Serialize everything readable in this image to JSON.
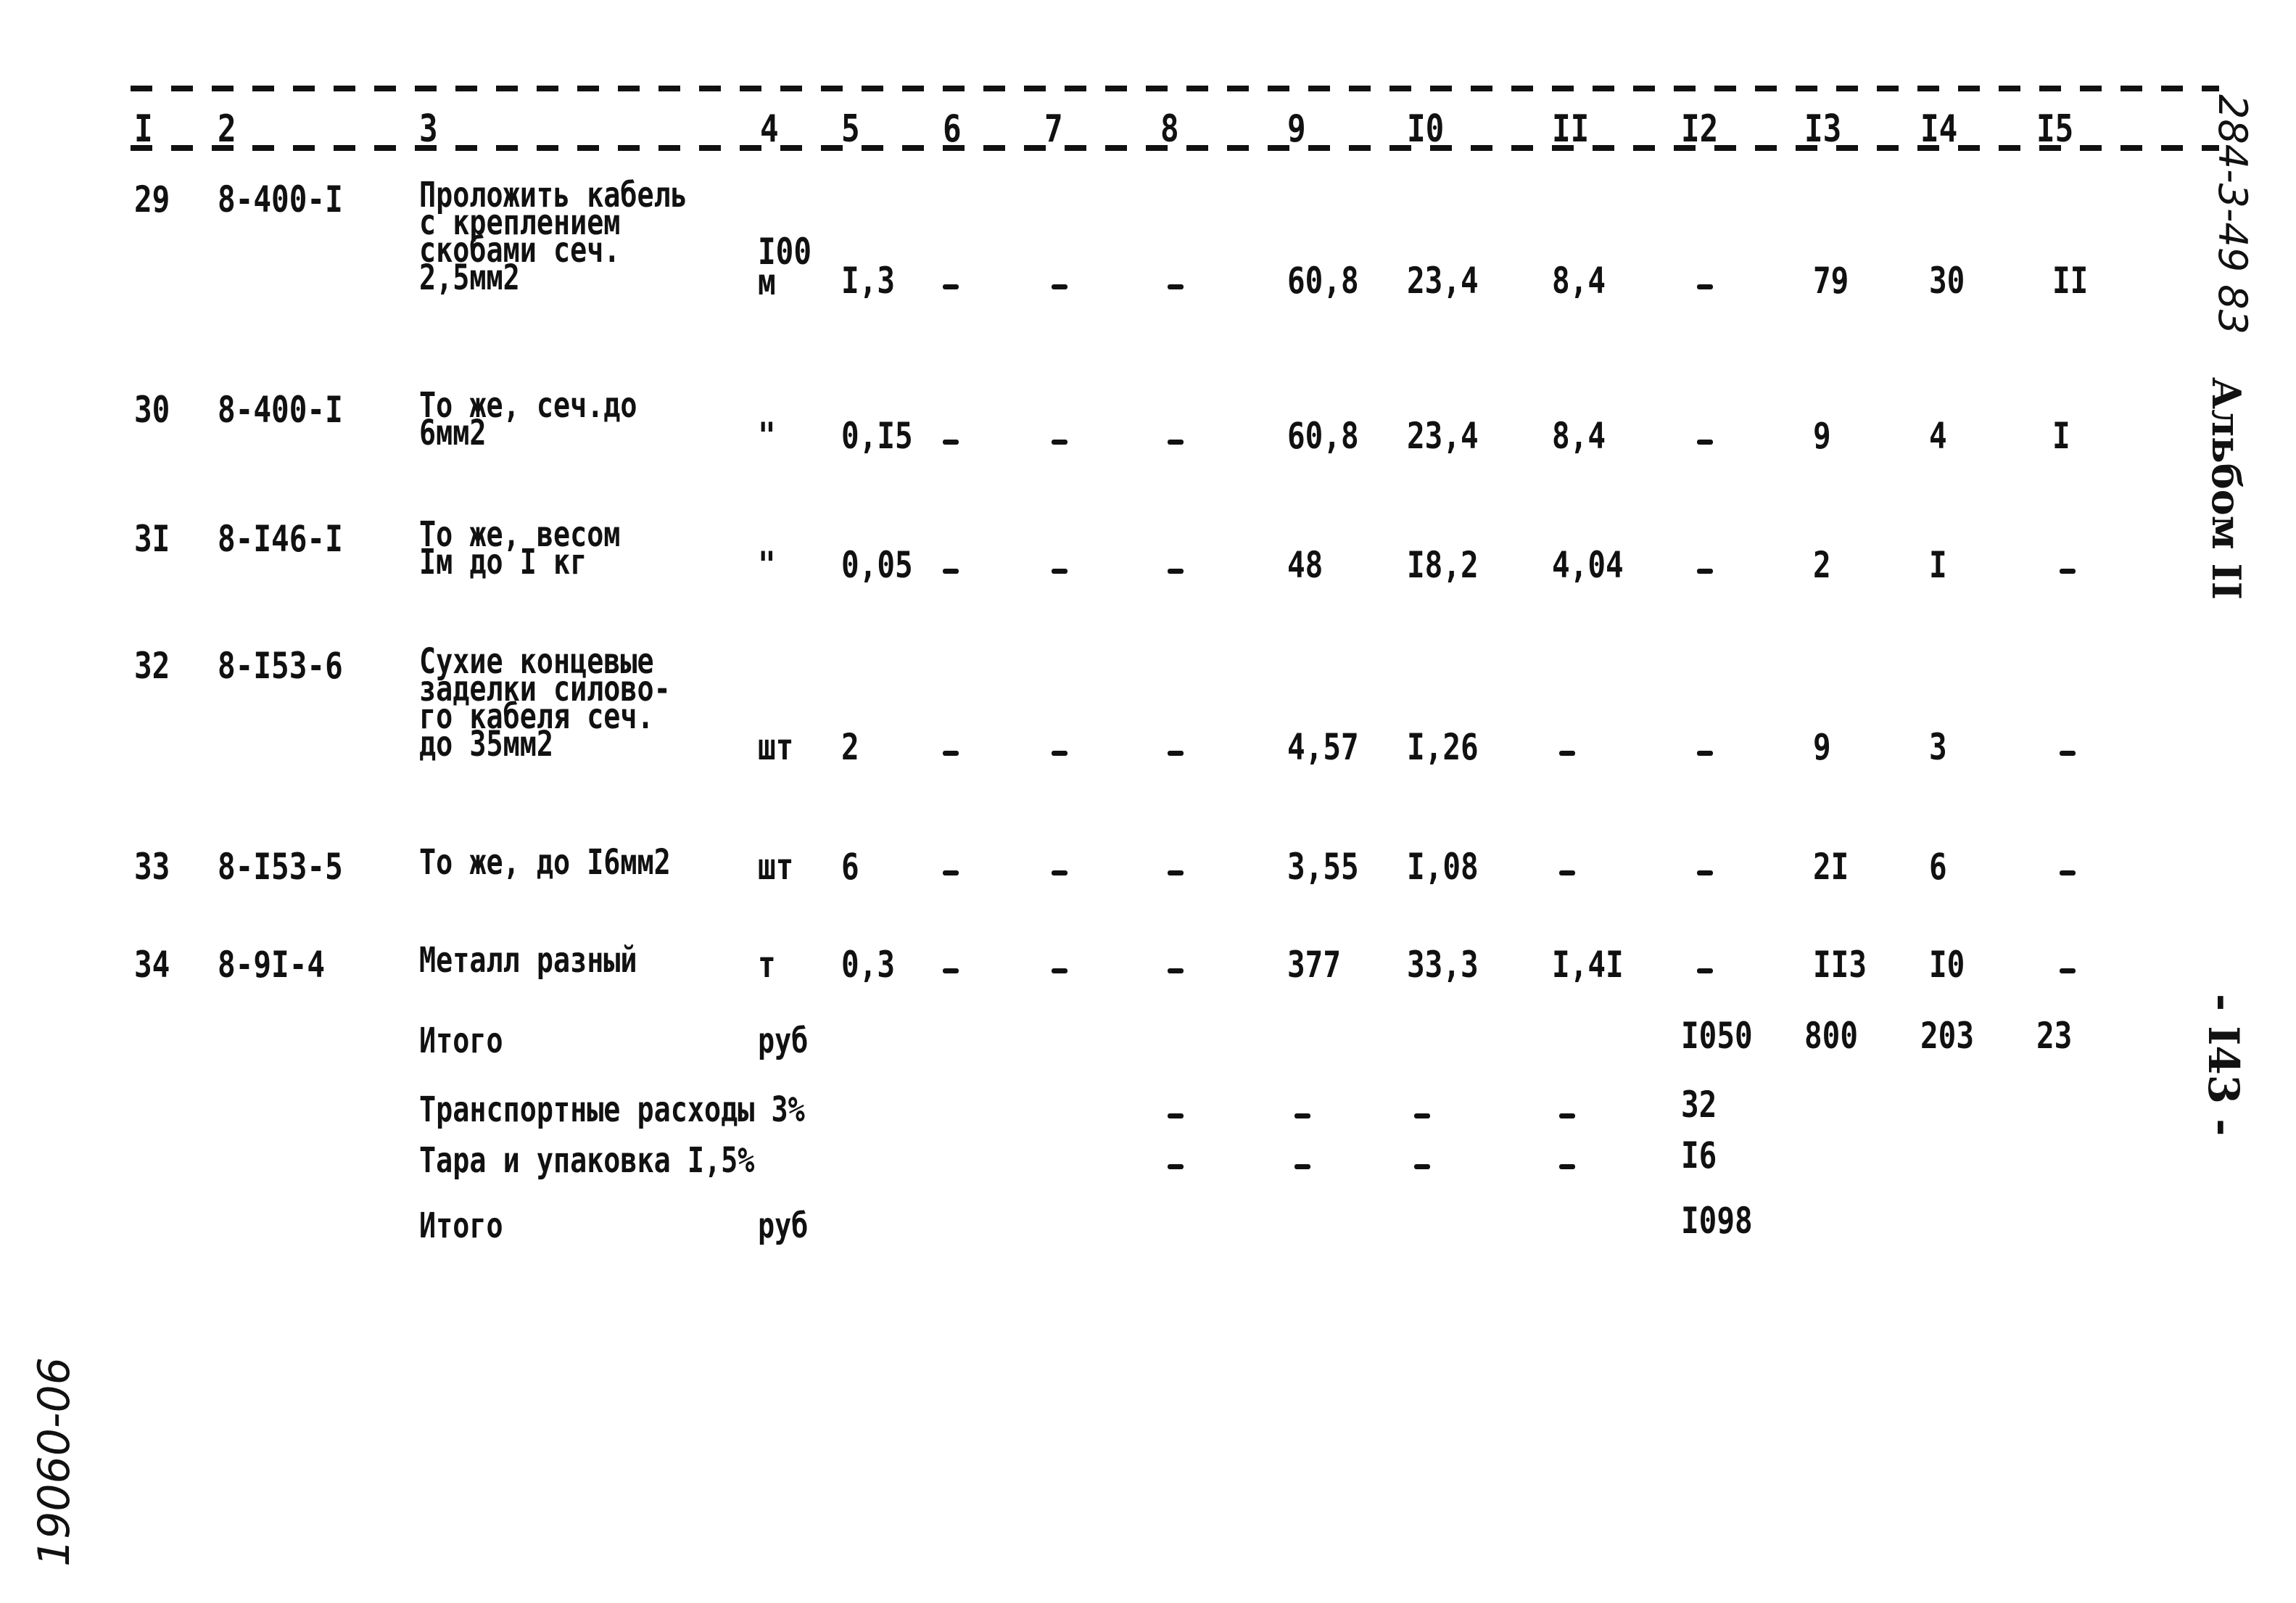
{
  "margin": {
    "right_code": "284-3-49 83",
    "right_album": "Альбом II",
    "page_number": "- I43 -",
    "left_handwritten": "19060-06"
  },
  "header": {
    "columns": [
      "I",
      "2",
      "3",
      "4",
      "5",
      "6",
      "7",
      "8",
      "9",
      "I0",
      "II",
      "I2",
      "I3",
      "I4",
      "I5"
    ]
  },
  "rows": [
    {
      "n": "29",
      "code": "8-400-I",
      "desc": [
        "Проложить кабель",
        "с креплением",
        "скобами сеч.",
        "2,5мм2"
      ],
      "unit": [
        "I00",
        "м"
      ],
      "c5": "I,3",
      "c6": "-",
      "c7": "-",
      "c8": "-",
      "c9": "60,8",
      "c10": "23,4",
      "c11": "8,4",
      "c12": "-",
      "c13": "79",
      "c14": "30",
      "c15": "II"
    },
    {
      "n": "30",
      "code": "8-400-I",
      "desc": [
        "То же, сеч.до",
        "6мм2"
      ],
      "unit": [
        "\""
      ],
      "c5": "0,I5",
      "c6": "-",
      "c7": "-",
      "c8": "-",
      "c9": "60,8",
      "c10": "23,4",
      "c11": "8,4",
      "c12": "-",
      "c13": "9",
      "c14": "4",
      "c15": "I"
    },
    {
      "n": "3I",
      "code": "8-I46-I",
      "desc": [
        "То же, весом",
        "Iм до I кг"
      ],
      "unit": [
        "\""
      ],
      "c5": "0,05",
      "c6": "-",
      "c7": "-",
      "c8": "-",
      "c9": "48",
      "c10": "I8,2",
      "c11": "4,04",
      "c12": "-",
      "c13": "2",
      "c14": "I",
      "c15": "-"
    },
    {
      "n": "32",
      "code": "8-I53-6",
      "desc": [
        "Сухие концевые",
        "заделки силово-",
        "го кабеля сеч.",
        "до 35мм2"
      ],
      "unit": [
        "шт"
      ],
      "c5": "2",
      "c6": "-",
      "c7": "-",
      "c8": "-",
      "c9": "4,57",
      "c10": "I,26",
      "c11": "-",
      "c12": "-",
      "c13": "9",
      "c14": "3",
      "c15": "-"
    },
    {
      "n": "33",
      "code": "8-I53-5",
      "desc": [
        "То же, до I6мм2"
      ],
      "unit": [
        "шт"
      ],
      "c5": "6",
      "c6": "-",
      "c7": "-",
      "c8": "-",
      "c9": "3,55",
      "c10": "I,08",
      "c11": "-",
      "c12": "-",
      "c13": "2I",
      "c14": "6",
      "c15": "-"
    },
    {
      "n": "34",
      "code": "8-9I-4",
      "desc": [
        "Металл разный"
      ],
      "unit": [
        "т"
      ],
      "c5": "0,3",
      "c6": "-",
      "c7": "-",
      "c8": "-",
      "c9": "377",
      "c10": "33,3",
      "c11": "I,4I",
      "c12": "-",
      "c13": "II3",
      "c14": "I0",
      "c15": "-"
    }
  ],
  "summary": {
    "total1": {
      "label": "Итого",
      "unit": "руб",
      "c12": "I050",
      "c13": "800",
      "c14": "203",
      "c15": "23"
    },
    "transport": {
      "label": "Транспортные расходы 3%",
      "c8": "-",
      "c9": "-",
      "c10": "-",
      "c11": "-",
      "c12": "32"
    },
    "packing": {
      "label": "Тара и упаковка I,5%",
      "c8": "-",
      "c9": "-",
      "c10": "-",
      "c11": "-",
      "c12": "I6"
    },
    "total2": {
      "label": "Итого",
      "unit": "руб",
      "c12": "I098"
    }
  }
}
